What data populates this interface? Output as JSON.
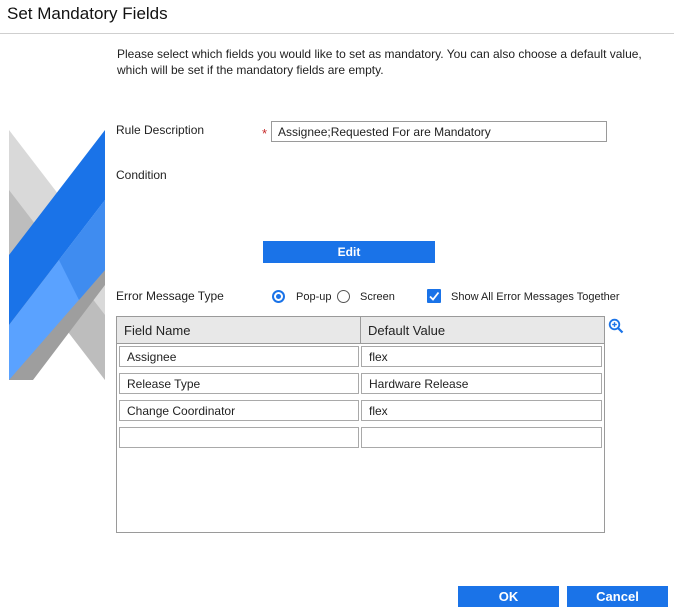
{
  "dialog": {
    "title": "Set Mandatory Fields",
    "intro": "Please select which fields you would like to set as mandatory. You can also choose a default value, which will be set if the mandatory fields are empty."
  },
  "form": {
    "rule_description_label": "Rule Description",
    "required_marker": "*",
    "rule_description_value": "Assignee;Requested For are Mandatory",
    "condition_label": "Condition",
    "edit_label": "Edit",
    "error_type_label": "Error Message Type",
    "popup_label": "Pop-up",
    "screen_label": "Screen",
    "popup_selected": true,
    "show_all_label": "Show All Error Messages Together",
    "show_all_checked": true
  },
  "table": {
    "col_field": "Field Name",
    "col_default": "Default Value",
    "rows": [
      {
        "field": "Assignee",
        "default": "flex"
      },
      {
        "field": "Release Type",
        "default": "Hardware Release"
      },
      {
        "field": "Change Coordinator",
        "default": "flex"
      },
      {
        "field": "",
        "default": ""
      }
    ]
  },
  "footer": {
    "ok_label": "OK",
    "cancel_label": "Cancel"
  },
  "colors": {
    "accent": "#1a73e8",
    "required": "#c62828"
  },
  "icons": {
    "zoom": "zoom-in-icon",
    "decor": "brand-decoration"
  }
}
